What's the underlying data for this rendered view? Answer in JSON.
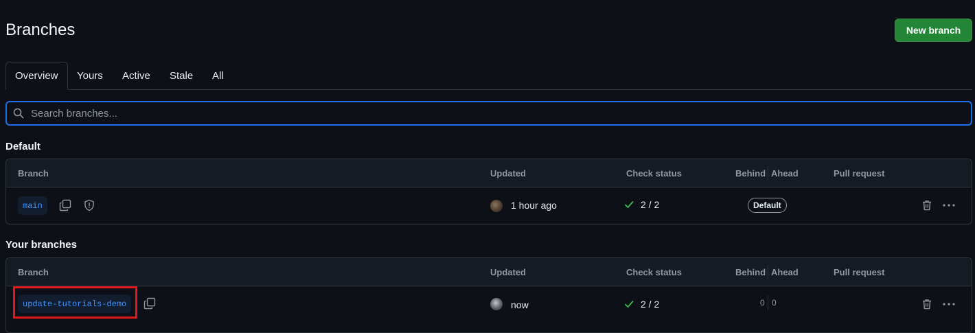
{
  "page": {
    "title": "Branches",
    "new_branch_label": "New branch"
  },
  "tabs": [
    {
      "label": "Overview",
      "active": true
    },
    {
      "label": "Yours"
    },
    {
      "label": "Active"
    },
    {
      "label": "Stale"
    },
    {
      "label": "All"
    }
  ],
  "search": {
    "placeholder": "Search branches...",
    "value": ""
  },
  "columns": {
    "branch": "Branch",
    "updated": "Updated",
    "check_status": "Check status",
    "behind": "Behind",
    "ahead": "Ahead",
    "pull_request": "Pull request"
  },
  "sections": {
    "default": {
      "label": "Default",
      "row": {
        "branch": "main",
        "updated": "1 hour ago",
        "check": "2 / 2",
        "badge": "Default",
        "icons": [
          "copy-icon",
          "shield-icon",
          "trash-icon",
          "kebab-icon"
        ]
      }
    },
    "yours": {
      "label": "Your branches",
      "row": {
        "branch": "update-tutorials-demo",
        "updated": "now",
        "check": "2 / 2",
        "behind": "0",
        "ahead": "0",
        "icons": [
          "copy-icon",
          "trash-icon",
          "kebab-icon"
        ]
      }
    }
  },
  "colors": {
    "background": "#0d1117",
    "primary_button": "#238636",
    "link": "#4493f8",
    "success": "#3fb950",
    "focus_border": "#1f6feb",
    "highlight": "#e5191c"
  }
}
